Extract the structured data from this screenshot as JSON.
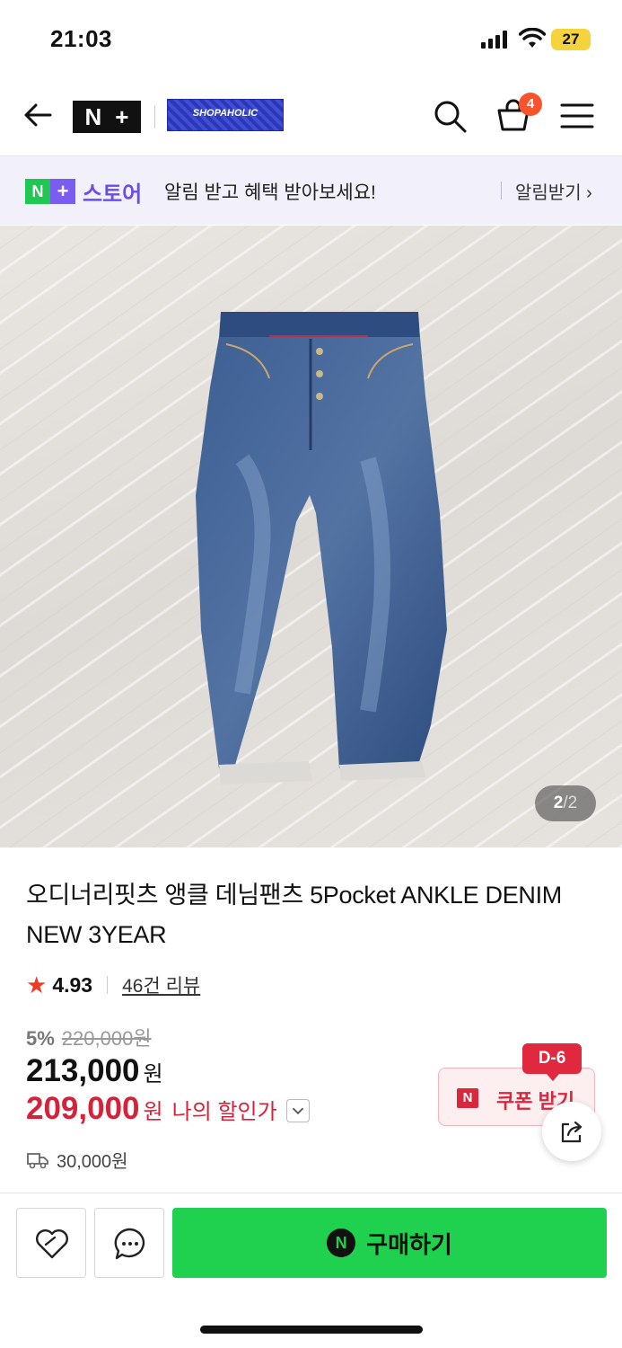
{
  "status_bar": {
    "time": "21:03",
    "battery": "27"
  },
  "header": {
    "logo_n": "N",
    "logo_plus": "+",
    "brand_logo_text": "SHOPAHOLIC",
    "cart_count": "4",
    "icons": [
      "back-arrow-icon",
      "search-icon",
      "cart-icon",
      "menu-icon"
    ]
  },
  "notice": {
    "badge_n": "N",
    "badge_plus": "+",
    "store_label": "스토어",
    "message": "알림 받고 혜택 받아보세요!",
    "cta": "알림받기 ›"
  },
  "gallery": {
    "current": "2",
    "separator": "/",
    "total": "2"
  },
  "product": {
    "title": "오디너리핏츠 앵클 데님팬츠 5Pocket ANKLE DENIM NEW 3YEAR",
    "rating": "4.93",
    "reviews": "46건 리뷰",
    "discount_pct": "5%",
    "original_price": "220,000원",
    "price": "213,000",
    "price_unit": "원",
    "my_price": "209,000",
    "my_price_unit": "원",
    "my_price_label": "나의 할인가",
    "shipping": "30,000원"
  },
  "coupon": {
    "dday": "D-6",
    "icon": "N",
    "label": "쿠폰 받기"
  },
  "bottom_bar": {
    "buy_icon": "N",
    "buy_label": "구매하기"
  },
  "colors": {
    "accent_green": "#1fd14e",
    "store_purple": "#6b4ce6",
    "price_red": "#d6213a",
    "cart_badge": "#f7542e"
  }
}
